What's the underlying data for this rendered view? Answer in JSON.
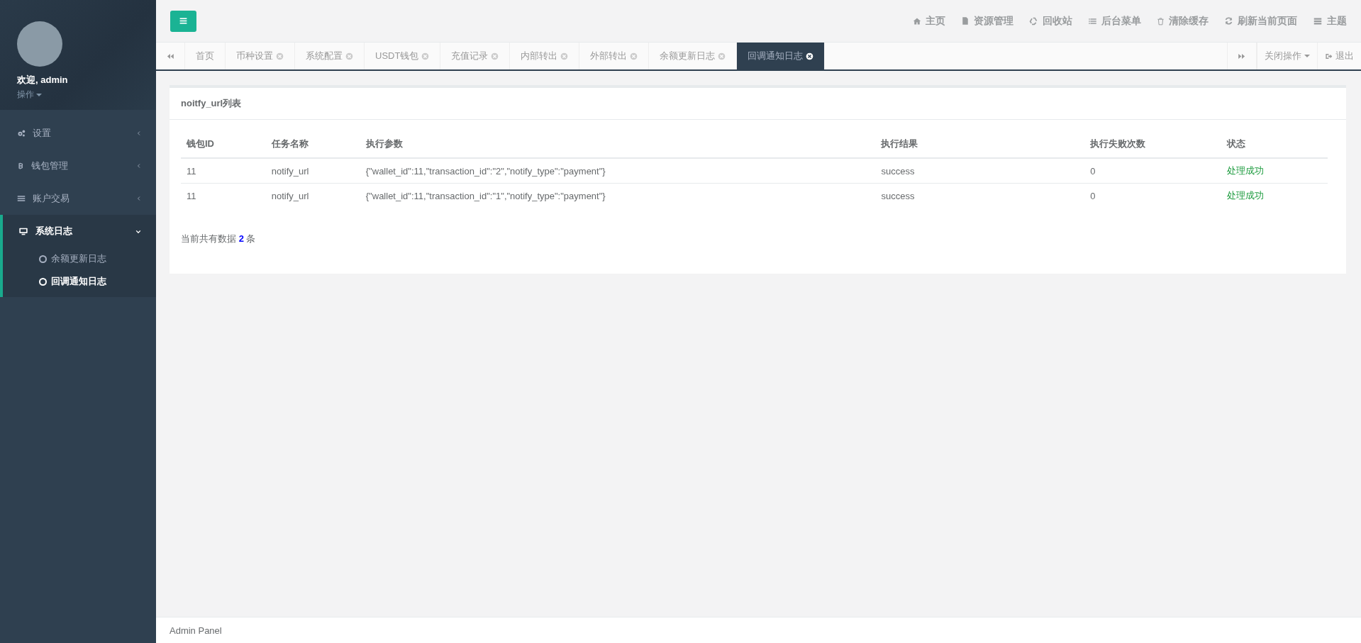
{
  "sidebar": {
    "welcome": "欢迎, admin",
    "profile_menu": "操作",
    "menu": [
      {
        "label": "设置",
        "expanded": false
      },
      {
        "label": "钱包管理",
        "expanded": false
      },
      {
        "label": "账户交易",
        "expanded": false
      },
      {
        "label": "系统日志",
        "expanded": true,
        "children": [
          {
            "label": "余额更新日志",
            "selected": false
          },
          {
            "label": "回调通知日志",
            "selected": true
          }
        ]
      }
    ]
  },
  "top_nav": [
    "主页",
    "资源管理",
    "回收站",
    "后台菜单",
    "清除缓存",
    "刷新当前页面",
    "主题"
  ],
  "tabs": [
    {
      "label": "首页",
      "closable": false,
      "selected": false
    },
    {
      "label": "币种设置",
      "closable": true,
      "selected": false
    },
    {
      "label": "系统配置",
      "closable": true,
      "selected": false
    },
    {
      "label": "USDT钱包",
      "closable": true,
      "selected": false
    },
    {
      "label": "充值记录",
      "closable": true,
      "selected": false
    },
    {
      "label": "内部转出",
      "closable": true,
      "selected": false
    },
    {
      "label": "外部转出",
      "closable": true,
      "selected": false
    },
    {
      "label": "余额更新日志",
      "closable": true,
      "selected": false
    },
    {
      "label": "回调通知日志",
      "closable": true,
      "selected": true
    }
  ],
  "tab_actions": {
    "close_menu": "关闭操作",
    "logout": "退出"
  },
  "panel": {
    "title": "noitfy_url列表",
    "table": {
      "columns": [
        "钱包ID",
        "任务名称",
        "执行参数",
        "执行结果",
        "执行失败次数",
        "状态"
      ],
      "rows": [
        [
          "11",
          "notify_url",
          "{\"wallet_id\":11,\"transaction_id\":\"2\",\"notify_type\":\"payment\"}",
          "success",
          "0",
          "处理成功"
        ],
        [
          "11",
          "notify_url",
          "{\"wallet_id\":11,\"transaction_id\":\"1\",\"notify_type\":\"payment\"}",
          "success",
          "0",
          "处理成功"
        ]
      ]
    },
    "count_text": "当前共有数据 **2** 条"
  },
  "footer": "Admin Panel"
}
